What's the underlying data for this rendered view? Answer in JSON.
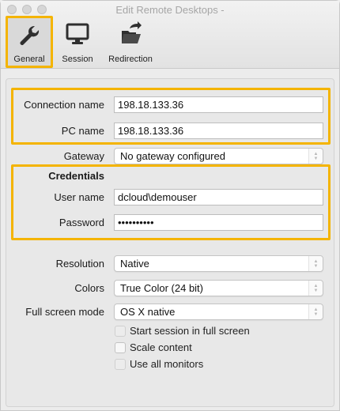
{
  "window": {
    "title": "Edit Remote Desktops -"
  },
  "toolbar": {
    "general": "General",
    "session": "Session",
    "redirection": "Redirection"
  },
  "general": {
    "connection_name_label": "Connection name",
    "connection_name_value": "198.18.133.36",
    "pc_name_label": "PC name",
    "pc_name_value": "198.18.133.36",
    "gateway_label": "Gateway",
    "gateway_value": "No gateway configured",
    "credentials_title": "Credentials",
    "user_name_label": "User name",
    "user_name_value": "dcloud\\demouser",
    "password_label": "Password",
    "password_value": "••••••••••",
    "resolution_label": "Resolution",
    "resolution_value": "Native",
    "colors_label": "Colors",
    "colors_value": "True Color (24 bit)",
    "fullscreen_label": "Full screen mode",
    "fullscreen_value": "OS X native",
    "start_fullscreen": "Start session in full screen",
    "scale_content": "Scale content",
    "use_all_monitors": "Use all monitors"
  },
  "colors": {
    "highlight": "#f4b400"
  }
}
